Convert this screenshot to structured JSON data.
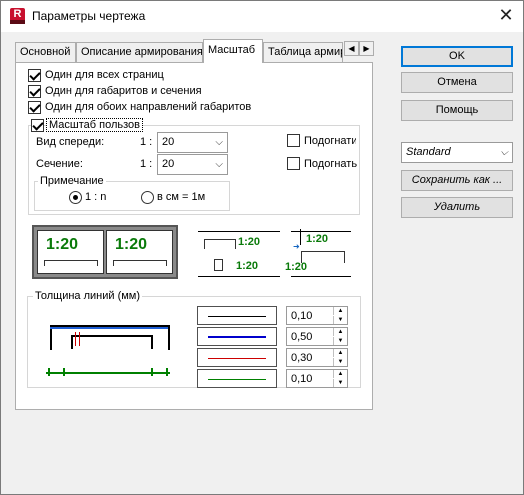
{
  "window": {
    "title": "Параметры чертежа",
    "app_icon_letter": "R"
  },
  "tabs": [
    {
      "label": "Основной"
    },
    {
      "label": "Описание армирования"
    },
    {
      "label": "Масштаб"
    },
    {
      "label": "Таблица армир"
    }
  ],
  "checks": {
    "all_pages": {
      "label": "Один для всех страниц",
      "checked": true
    },
    "dims_sections": {
      "label": "Один для габаритов и сечения",
      "checked": true
    },
    "both_directions": {
      "label": "Один для обоих направлений габаритов",
      "checked": true
    },
    "user_scale": {
      "label": "Масштаб пользов",
      "checked": true
    }
  },
  "scale": {
    "front_label": "Вид спереди:",
    "front_prefix": "1 :",
    "front_value": "20",
    "section_label": "Сечение:",
    "section_prefix": "1 :",
    "section_value": "20",
    "fit1_label": "Подогнати",
    "fit2_label": "Подогнать"
  },
  "note": {
    "title": "Примечание",
    "opt1": "1 : n",
    "opt2": "в см = 1м"
  },
  "previews": {
    "big_label_left": "1:20",
    "big_label_right": "1:20",
    "mid_label_top": "1:20",
    "mid_label_bottom": "1:20",
    "right_label_top": "1:20",
    "right_label_bottom": "1:20"
  },
  "line_thickness": {
    "title": "Толщина линий (мм)",
    "rows": [
      {
        "value": "0,10",
        "color": "#000000"
      },
      {
        "value": "0,50",
        "color": "#0000cc"
      },
      {
        "value": "0,30",
        "color": "#cc0000"
      },
      {
        "value": "0,10",
        "color": "#008000"
      }
    ]
  },
  "buttons": {
    "ok": "OK",
    "cancel": "Отмена",
    "help": "Помощь",
    "save_as": "Сохранить как ...",
    "delete": "Удалить"
  },
  "preset": {
    "value": "Standard"
  }
}
